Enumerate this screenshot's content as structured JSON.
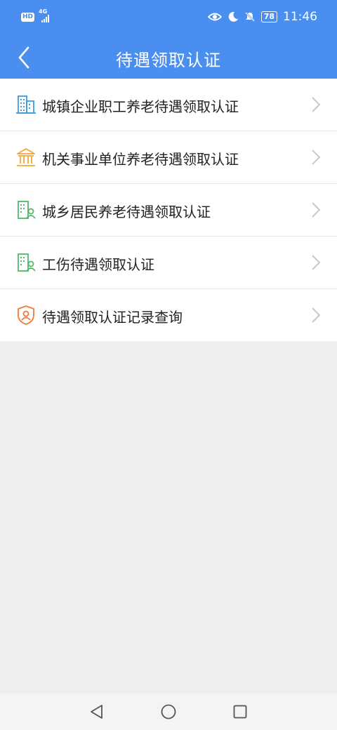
{
  "status_bar": {
    "hd": "HD",
    "network": "4G",
    "battery": "78",
    "time": "11:46"
  },
  "header": {
    "title": "待遇领取认证"
  },
  "menu": {
    "items": [
      {
        "label": "城镇企业职工养老待遇领取认证",
        "icon": "building-icon",
        "color": "#3d9be0"
      },
      {
        "label": "机关事业单位养老待遇领取认证",
        "icon": "institution-icon",
        "color": "#f0a83a"
      },
      {
        "label": "城乡居民养老待遇领取认证",
        "icon": "resident-building-icon",
        "color": "#4fb86a"
      },
      {
        "label": "工伤待遇领取认证",
        "icon": "resident-building-icon",
        "color": "#4fb86a"
      },
      {
        "label": "待遇领取认证记录查询",
        "icon": "shield-user-icon",
        "color": "#f07a3a"
      }
    ]
  },
  "colors": {
    "header_bg": "#4a8ef0",
    "page_bg": "#eeeff1"
  }
}
